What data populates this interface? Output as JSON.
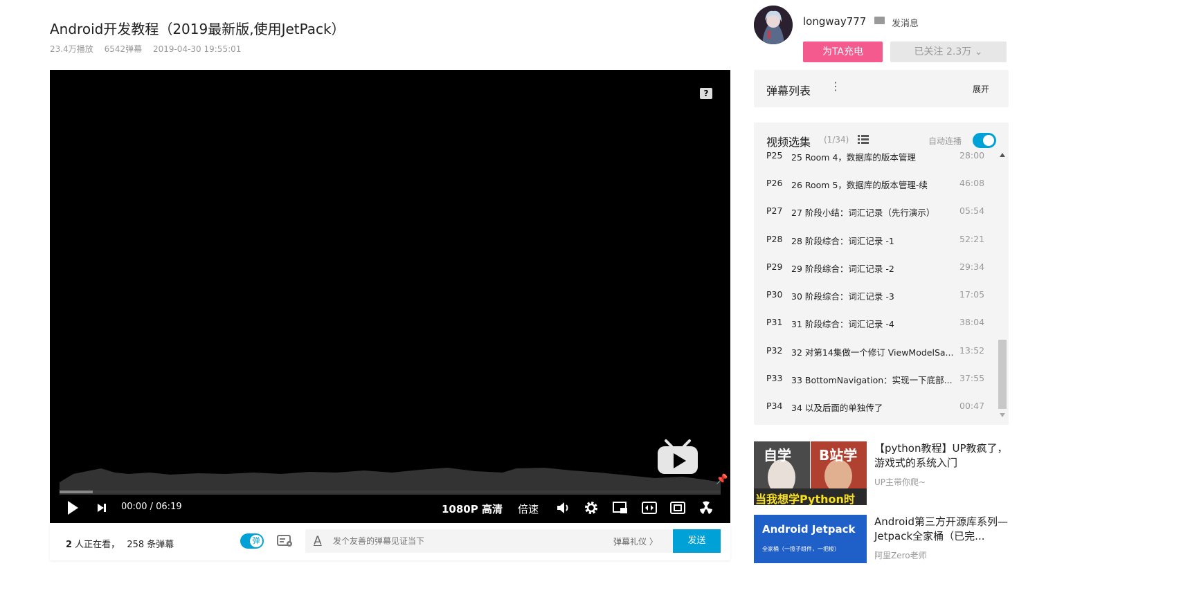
{
  "video": {
    "title": "Android开发教程（2019最新版,使用JetPack）",
    "views": "23.4万播放",
    "danmaku_count": "6542弹幕",
    "date": "2019-04-30 19:55:01"
  },
  "player": {
    "help_icon": "?",
    "time_current": "00:00",
    "time_separator": "/",
    "time_total": "06:19",
    "quality": "1080P 高清",
    "speed": "倍速",
    "progress_fraction": 0.05
  },
  "danmaku_bar": {
    "viewers_num": "2",
    "viewers_text": " 人正在看，",
    "danmaku_num": "258",
    "danmaku_text": " 条弹幕",
    "toggle_label": "弹",
    "font_glyph": "A",
    "input_placeholder": "发个友善的弹幕见证当下",
    "etiquette": "弹幕礼仪 〉",
    "send": "发送"
  },
  "uploader": {
    "name": "longway777",
    "send_message": "发消息",
    "charge": "为TA充电",
    "follow": "已关注 2.3万 ⌄"
  },
  "danmaku_list": {
    "title": "弹幕列表",
    "more": "⋮",
    "expand": "展开"
  },
  "episodes": {
    "title": "视频选集",
    "count": "(1/34)",
    "autoplay": "自动连播",
    "items": [
      {
        "p": "P25",
        "title": "25 Room 4，数据库的版本管理",
        "duration": "28:00"
      },
      {
        "p": "P26",
        "title": "26 Room 5，数据库的版本管理-续",
        "duration": "46:08"
      },
      {
        "p": "P27",
        "title": "27 阶段小结：词汇记录（先行演示）",
        "duration": "05:54"
      },
      {
        "p": "P28",
        "title": "28 阶段综合：词汇记录 -1",
        "duration": "52:21"
      },
      {
        "p": "P29",
        "title": "29 阶段综合：词汇记录 -2",
        "duration": "29:34"
      },
      {
        "p": "P30",
        "title": "30 阶段综合：词汇记录 -3",
        "duration": "17:05"
      },
      {
        "p": "P31",
        "title": "31 阶段综合：词汇记录 -4",
        "duration": "38:04"
      },
      {
        "p": "P32",
        "title": "32 对第14集做一个修订 ViewModelSa...",
        "duration": "13:52"
      },
      {
        "p": "P33",
        "title": "33 BottomNavigation：实现一下底部...",
        "duration": "37:55"
      },
      {
        "p": "P34",
        "title": "34 以及后面的单独传了",
        "duration": "00:47"
      }
    ]
  },
  "recommendations": [
    {
      "title": "【python教程】UP教疯了，游戏式的系统入门",
      "author": "UP主带你爬~",
      "thumb_text_left": "自学",
      "thumb_text_right": "B站学",
      "thumb_caption": "当我想学Python时"
    },
    {
      "title": "Android第三方开源库系列—Jetpack全家桶（已完...",
      "author": "阿里Zero老师",
      "thumb_text": "Android Jetpack",
      "thumb_subtext": "全家桶（一揽子组件，一把梭）"
    }
  ],
  "colors": {
    "accent_blue": "#00a1d6",
    "charge_pink": "#f45a8d",
    "panel_bg": "#f4f4f4"
  }
}
